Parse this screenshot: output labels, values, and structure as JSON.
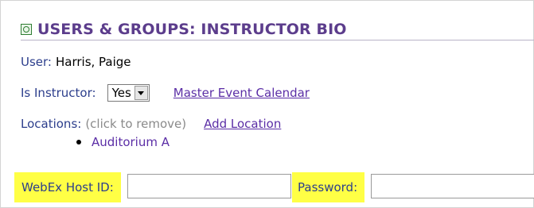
{
  "header": {
    "title": "USERS & GROUPS: INSTRUCTOR BIO"
  },
  "user": {
    "label": "User:",
    "value": "Harris, Paige"
  },
  "instructor": {
    "label": "Is Instructor:",
    "selected": "Yes",
    "calendar_link": "Master Event Calendar"
  },
  "locations": {
    "label": "Locations:",
    "hint": "(click to remove)",
    "add_link": "Add Location",
    "items": [
      "Auditorium A"
    ]
  },
  "webex": {
    "host_label": "WebEx Host ID:",
    "host_value": "",
    "password_label": "Password:",
    "password_value": ""
  },
  "colors": {
    "highlight": "#ffff45",
    "title": "#5c3d8c",
    "label": "#2c3e8c",
    "link": "#5b2ea6"
  }
}
